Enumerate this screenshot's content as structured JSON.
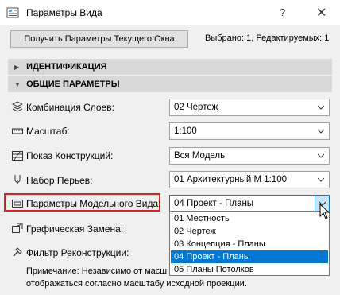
{
  "window": {
    "title": "Параметры Вида",
    "help_glyph": "?",
    "close_glyph": "✕"
  },
  "toolbar": {
    "get_button": "Получить Параметры Текущего Окна",
    "selected_info": "Выбрано: 1, Редактируемых: 1"
  },
  "sections": [
    {
      "label": "ИДЕНТИФИКАЦИЯ",
      "expanded": false
    },
    {
      "label": "ОБЩИЕ ПАРАМЕТРЫ",
      "expanded": true
    }
  ],
  "rows": {
    "layers": {
      "label": "Комбинация Слоев:",
      "value": "02 Чертеж",
      "icon": "layers-icon"
    },
    "scale": {
      "label": "Масштаб:",
      "value": "1:100",
      "icon": "ruler-icon"
    },
    "structure": {
      "label": "Показ Конструкций:",
      "value": "Вся Модель",
      "icon": "structure-hatch-icon"
    },
    "pens": {
      "label": "Набор Перьев:",
      "value": "01 Архитектурный М 1:100",
      "icon": "pen-icon"
    },
    "model_view": {
      "label": "Параметры Модельного Вида:",
      "value": "04 Проект - Планы",
      "icon": "model-view-icon"
    },
    "graphic_override": {
      "label": "Графическая Замена:",
      "icon": "graphic-override-icon"
    },
    "renovation": {
      "label": "Фильтр Реконструкции:",
      "icon": "renovation-filter-icon"
    }
  },
  "dropdown": {
    "options": [
      "01 Местность",
      "02 Чертеж",
      "03 Концепция - Планы",
      "04 Проект - Планы",
      "05 Планы Потолков"
    ],
    "selected_index": 3
  },
  "note": {
    "line1": "Примечание: Независимо от масш",
    "line2": "отображаться согласно масштабу исходной проекции."
  },
  "colors": {
    "highlight_box": "#e02020",
    "selection": "#0078d7",
    "section_bg": "#d8d8d8"
  }
}
